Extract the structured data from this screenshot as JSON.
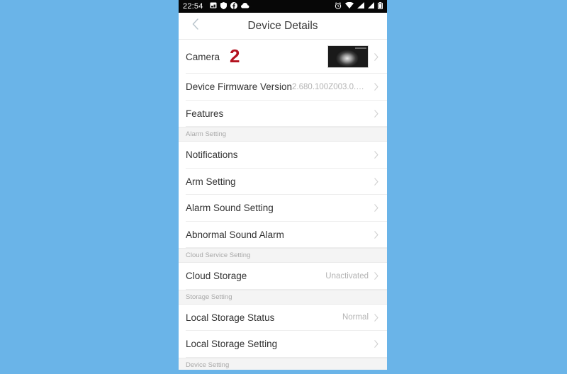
{
  "background_color": "#6ab4e8",
  "status_bar": {
    "time": "22:54",
    "left_icons": [
      "photo-icon",
      "shield-icon",
      "facebook-icon",
      "cloud-icon"
    ],
    "right_icons": [
      "alarm-clock-icon",
      "wifi-icon",
      "signal-icon",
      "signal-icon-2",
      "battery-icon"
    ]
  },
  "titlebar": {
    "back_icon": "chevron-left-icon",
    "title": "Device Details"
  },
  "annotation": {
    "marker": "2",
    "color": "#b3121f"
  },
  "list": [
    {
      "kind": "row",
      "name": "camera",
      "label": "Camera",
      "value": "",
      "thumbnail": true,
      "annotation": "2",
      "chevron": true
    },
    {
      "kind": "row",
      "name": "device-firmware-version",
      "label": "Device Firmware Version",
      "value": "2.680.100Z003.0.R...",
      "chevron": true
    },
    {
      "kind": "row",
      "name": "features",
      "label": "Features",
      "value": "",
      "chevron": true
    },
    {
      "kind": "section",
      "name": "alarm-setting",
      "label": "Alarm Setting"
    },
    {
      "kind": "row",
      "name": "notifications",
      "label": "Notifications",
      "value": "",
      "chevron": true
    },
    {
      "kind": "row",
      "name": "arm-setting",
      "label": "Arm Setting",
      "value": "",
      "chevron": true
    },
    {
      "kind": "row",
      "name": "alarm-sound-setting",
      "label": "Alarm Sound Setting",
      "value": "",
      "chevron": true
    },
    {
      "kind": "row",
      "name": "abnormal-sound-alarm",
      "label": "Abnormal Sound Alarm",
      "value": "",
      "chevron": true
    },
    {
      "kind": "section",
      "name": "cloud-service-setting",
      "label": "Cloud Service Setting"
    },
    {
      "kind": "row",
      "name": "cloud-storage",
      "label": "Cloud Storage",
      "value": "Unactivated",
      "chevron": true
    },
    {
      "kind": "section",
      "name": "storage-setting",
      "label": "Storage Setting"
    },
    {
      "kind": "row",
      "name": "local-storage-status",
      "label": "Local Storage Status",
      "value": "Normal",
      "chevron": true
    },
    {
      "kind": "row",
      "name": "local-storage-setting",
      "label": "Local Storage Setting",
      "value": "",
      "chevron": true
    },
    {
      "kind": "section",
      "name": "device-setting",
      "label": "Device Setting"
    }
  ]
}
